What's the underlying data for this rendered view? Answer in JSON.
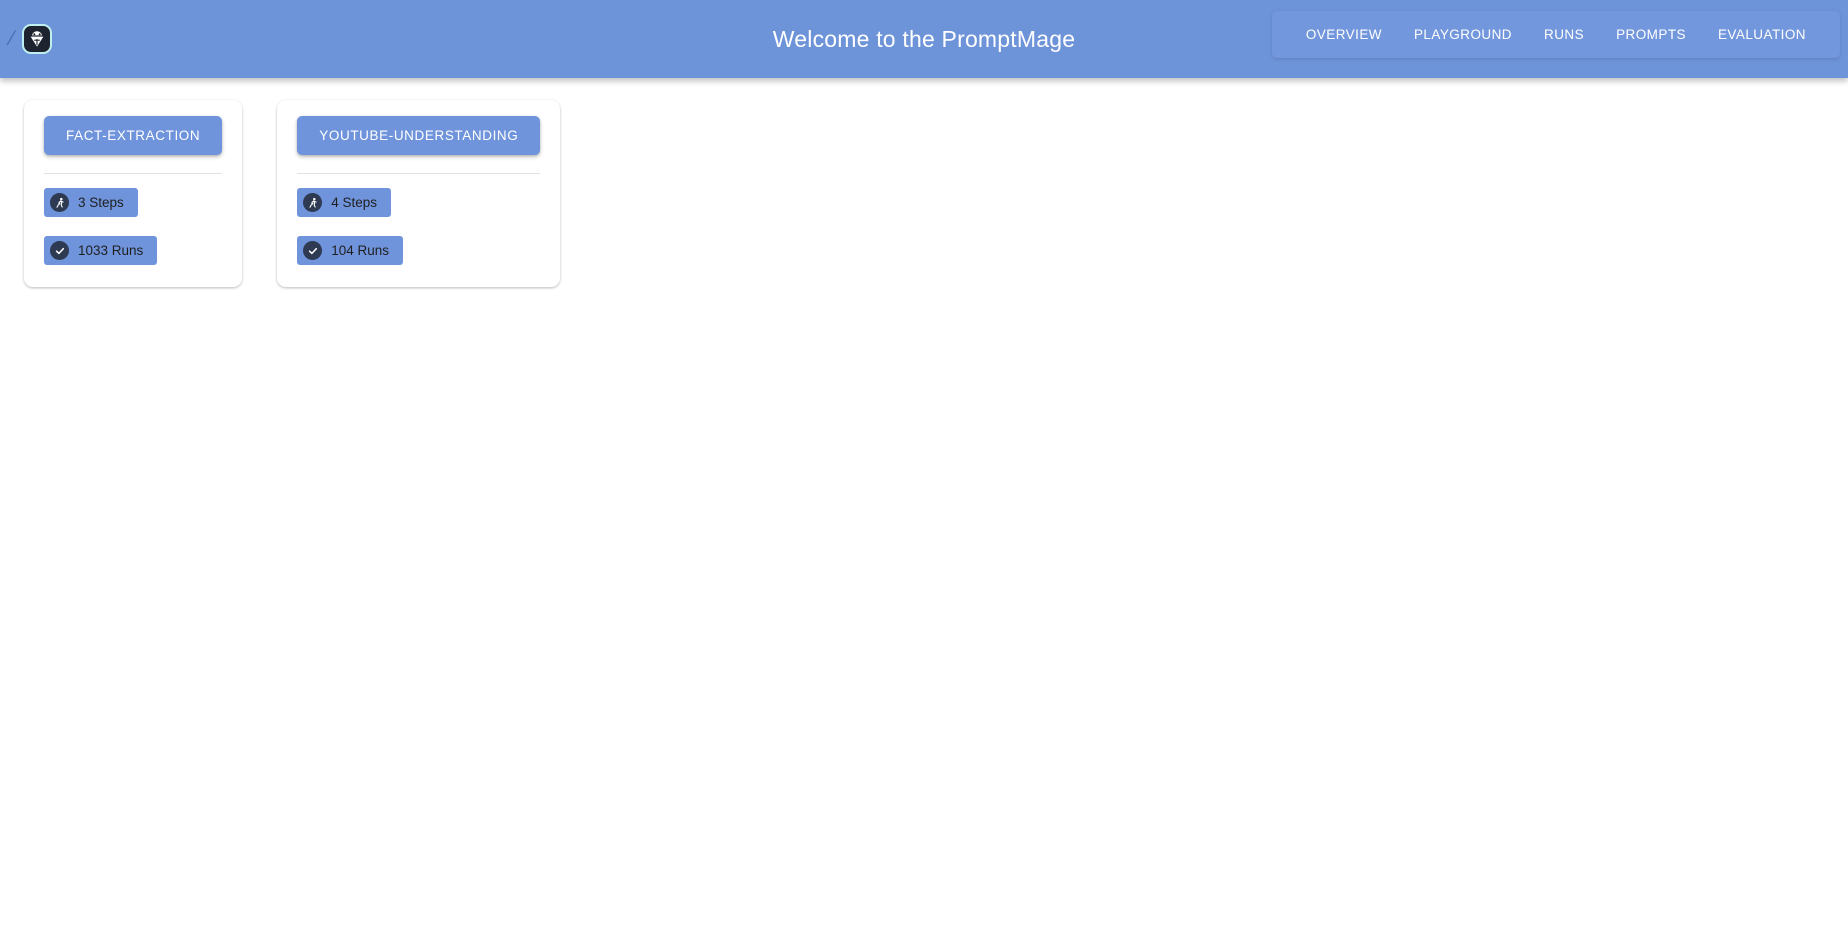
{
  "header": {
    "title": "Welcome to the PromptMage",
    "logo_icon": "promptmage-wizard-logo",
    "slash_mark": "/",
    "nav": [
      {
        "label": "Overview",
        "icon": "overview-nav"
      },
      {
        "label": "Playground",
        "icon": "playground-nav"
      },
      {
        "label": "Runs",
        "icon": "runs-nav"
      },
      {
        "label": "Prompts",
        "icon": "prompts-nav"
      },
      {
        "label": "Evaluation",
        "icon": "evaluation-nav"
      }
    ]
  },
  "colors": {
    "header_blue": "#6d93d9",
    "nav_blue": "#7397dd",
    "button_blue": "#6f94db",
    "icon_dark": "#2d3a51",
    "card_white": "#ffffff",
    "divider": "#e2e2e2",
    "logo_border": "#bff0ef"
  },
  "flows": [
    {
      "name": "fact-extraction",
      "steps": {
        "icon": "running-person-icon",
        "label": "3 Steps",
        "count": 3
      },
      "runs": {
        "icon": "check-circle-icon",
        "label": "1033 Runs",
        "count": 1033
      }
    },
    {
      "name": "youtube-understanding",
      "steps": {
        "icon": "running-person-icon",
        "label": "4 Steps",
        "count": 4
      },
      "runs": {
        "icon": "check-circle-icon",
        "label": "104 Runs",
        "count": 104
      }
    }
  ]
}
